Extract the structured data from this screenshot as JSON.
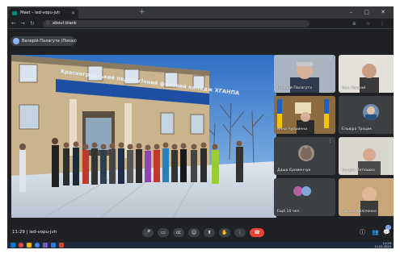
{
  "browser": {
    "tabs": [
      {
        "title": "Meet – ied-vopu-jvh"
      },
      {
        "title": ""
      }
    ],
    "new_tab": "+",
    "window_controls": "– ▢ ✕",
    "address": "about:blank",
    "toolbar_icons": "⊕ ☆ ⋮"
  },
  "meet": {
    "presenter": "Валерій Палагута (Показ)",
    "presentation": {
      "sign_text": "Красноградський педагогічний фаховий коледж ХГАНПА"
    },
    "participants": [
      {
        "name": "Валерій Палагута",
        "kind": "video-man"
      },
      {
        "name": "Іван Маскай",
        "kind": "video-man-white"
      },
      {
        "name": "Анна Чупринна",
        "kind": "video-office"
      },
      {
        "name": "Ельвіра Троцик",
        "kind": "avatar-photo"
      },
      {
        "name": "Даша Єременчук",
        "kind": "avatar-cat"
      },
      {
        "name": "Богдан Тетюшко",
        "kind": "video-teen"
      },
      {
        "name": "Ещё 10 чел.",
        "kind": "overflow"
      },
      {
        "name": "Оксана Філіпенко",
        "kind": "video-woman"
      }
    ],
    "bottom": {
      "time": "11:29",
      "separator": "|",
      "meeting_code": "ied-vopu-jvh",
      "controls": [
        {
          "name": "mic-button",
          "glyph": "🎤"
        },
        {
          "name": "camera-button",
          "glyph": "▭"
        },
        {
          "name": "captions-button",
          "glyph": "㏄"
        },
        {
          "name": "emoji-button",
          "glyph": "☺"
        },
        {
          "name": "present-button",
          "glyph": "⬆"
        },
        {
          "name": "raise-hand-button",
          "glyph": "✋"
        },
        {
          "name": "more-options-button",
          "glyph": "⋮"
        },
        {
          "name": "end-call-button",
          "glyph": "☎"
        }
      ],
      "right_controls": [
        {
          "name": "info-button",
          "glyph": "ⓘ"
        },
        {
          "name": "people-button",
          "glyph": "👥"
        },
        {
          "name": "chat-button",
          "glyph": "💬"
        }
      ],
      "people_count": "17"
    }
  },
  "taskbar": {
    "clock_time": "11:29",
    "clock_date": "11.02.2024"
  },
  "colors": {
    "meet_bg": "#202124",
    "tile_bg": "#3c4043",
    "end_call": "#ea4335",
    "accent": "#8ab4f8"
  }
}
